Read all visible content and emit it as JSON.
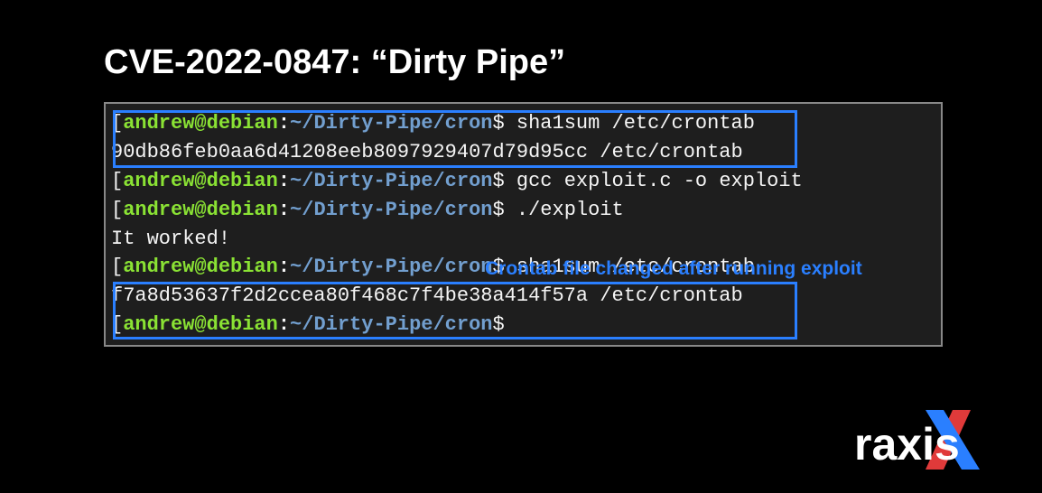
{
  "title": "CVE-2022-0847: “Dirty Pipe”",
  "prompt": {
    "user": "andrew",
    "at": "@",
    "host": "debian",
    "colon": ":",
    "path": "~/Dirty-Pipe/cron",
    "dollar": "$"
  },
  "lines": [
    {
      "type": "prompt",
      "cmd": " sha1sum /etc/crontab"
    },
    {
      "type": "output",
      "text": "90db86feb0aa6d41208eeb8097929407d79d95cc  /etc/crontab"
    },
    {
      "type": "prompt",
      "cmd": " gcc exploit.c -o exploit"
    },
    {
      "type": "prompt",
      "cmd": " ./exploit"
    },
    {
      "type": "output",
      "text": "It worked!"
    },
    {
      "type": "prompt",
      "cmd": " sha1sum /etc/crontab"
    },
    {
      "type": "output",
      "text": "f7a8d53637f2d2ccea80f468c7f4be38a414f57a  /etc/crontab"
    },
    {
      "type": "prompt",
      "cmd": ""
    }
  ],
  "annotation": "Crontab file changed after running exploit",
  "logo": "raxis"
}
